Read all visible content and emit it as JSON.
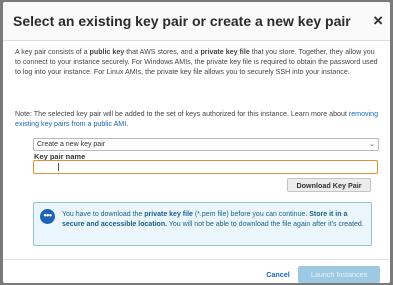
{
  "dialog": {
    "title": "Select an existing key pair or create a new key pair",
    "close_label": "×"
  },
  "intro": {
    "t1": "A key pair consists of a ",
    "b1": "public key",
    "t2": " that AWS stores, and a ",
    "b2": "private key file",
    "t3": " that you store. Together, they allow you to connect to your instance securely. For Windows AMIs, the private key file is required to obtain the password used to log into your instance. For Linux AMIs, the private key file allows you to securely SSH into your instance."
  },
  "note": {
    "text": "Note: The selected key pair will be added to the set of keys authorized for this instance. Learn more about ",
    "link": "removing existing key pairs from a public AMI",
    "end": "."
  },
  "key_select": {
    "selected": "Create a new key pair"
  },
  "key_name": {
    "label": "Key pair name",
    "value": ""
  },
  "buttons": {
    "download": "Download Key Pair",
    "cancel": "Cancel",
    "launch": "Launch Instances"
  },
  "info": {
    "icon": "chat-bubble-icon",
    "t1": "You have to download the ",
    "b1": "private key file",
    "t2": " (*.pem file) before you can continue. ",
    "b2": "Store it in a secure and accessible location.",
    "t3": " You will not be able to download the file again after it's created."
  },
  "colors": {
    "accent": "#1e63b5",
    "input_border": "#e0923a",
    "info_bg": "#eaf6fb"
  }
}
